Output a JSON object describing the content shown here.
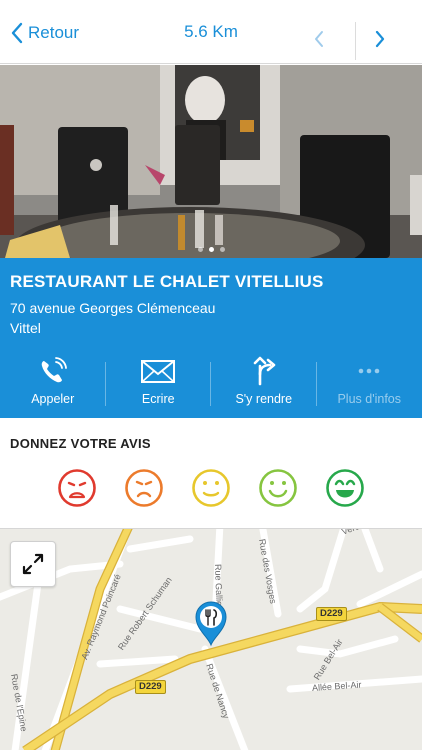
{
  "navbar": {
    "back_label": "Retour",
    "title": "5.6 Km"
  },
  "gallery": {
    "dot_count": 3,
    "active_dot": 2
  },
  "place": {
    "name": "RESTAURANT LE CHALET VITELLIUS",
    "address_line1": "70  avenue Georges Clémenceau",
    "address_line2": "Vittel"
  },
  "actions": [
    {
      "label": "Appeler",
      "icon": "phone-icon"
    },
    {
      "label": "Ecrire",
      "icon": "envelope-icon"
    },
    {
      "label": "S'y rendre",
      "icon": "directions-icon"
    },
    {
      "label": "Plus d'infos",
      "icon": "more-dots-icon"
    }
  ],
  "feedback": {
    "title": "DONNEZ VOTRE AVIS",
    "ratings": [
      {
        "name": "very-unhappy",
        "color": "#e03a2e"
      },
      {
        "name": "unhappy",
        "color": "#ec7b2c"
      },
      {
        "name": "neutral",
        "color": "#e7c72c"
      },
      {
        "name": "happy",
        "color": "#86c540"
      },
      {
        "name": "very-happy",
        "color": "#27a84b"
      }
    ]
  },
  "map": {
    "streets": [
      "Av. Raymond Poincaré",
      "Rue Gallieni",
      "Rue des Vosges",
      "Rue de l'Epine",
      "Rue Robert Schuman",
      "Rue de Nancy",
      "Rue Bel-Air",
      "Allée Bel-Air",
      "Verdun"
    ],
    "road_badges": [
      "D229",
      "D229"
    ]
  },
  "colors": {
    "accent": "#1a8fd8"
  }
}
